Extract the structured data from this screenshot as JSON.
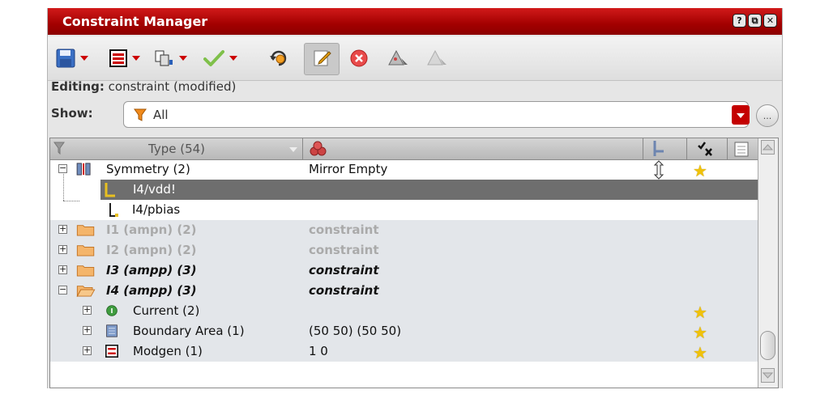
{
  "window": {
    "title": "Constraint Manager",
    "buttons": [
      "?",
      "⧉",
      "✕"
    ]
  },
  "toolbar": {
    "items": [
      "save-icon",
      "grid-icon",
      "copy-icon",
      "check-icon",
      "refresh-icon",
      "edit-icon",
      "delete-icon",
      "warning-icon",
      "warning-disabled-icon"
    ]
  },
  "editing": {
    "label": "Editing:",
    "value": "constraint (modified)"
  },
  "show": {
    "label": "Show:",
    "value": "All",
    "more_label": "..."
  },
  "grid": {
    "header": {
      "type_label": "Type (54)"
    },
    "rows": [
      {
        "name": "Symmetry (2)",
        "value": "Mirror Empty"
      },
      {
        "name": "I4/vdd!",
        "value": ""
      },
      {
        "name": "I4/pbias",
        "value": ""
      },
      {
        "name": "I1 (ampn) (2)",
        "value": "constraint"
      },
      {
        "name": "I2 (ampn) (2)",
        "value": "constraint"
      },
      {
        "name": "I3 (ampp) (3)",
        "value": "constraint"
      },
      {
        "name": "I4 (ampp) (3)",
        "value": "constraint"
      },
      {
        "name": "Current (2)",
        "value": ""
      },
      {
        "name": "Boundary Area (1)",
        "value": "(50 50) (50 50)"
      },
      {
        "name": "Modgen (1)",
        "value": "1 0"
      }
    ]
  },
  "colors": {
    "title_bar": "#b00000",
    "selected_row": "#6e6e6e",
    "group_row": "#e3e6ea",
    "star": "#f0c20a"
  }
}
